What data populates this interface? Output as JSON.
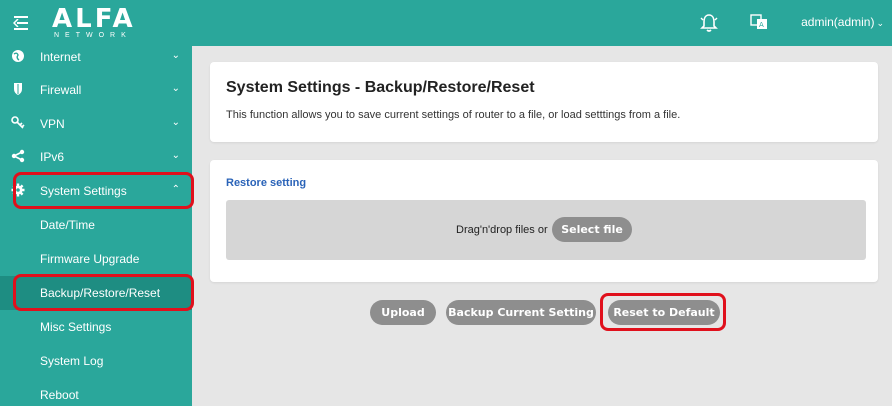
{
  "header": {
    "logo_text": "ALFA",
    "logo_sub": "NETWORK",
    "user_label": "admin(admin)"
  },
  "sidebar": {
    "items": [
      {
        "label": "Internet",
        "icon": "globe-icon"
      },
      {
        "label": "Firewall",
        "icon": "shield-icon"
      },
      {
        "label": "VPN",
        "icon": "key-icon"
      },
      {
        "label": "IPv6",
        "icon": "share-icon"
      },
      {
        "label": "System Settings",
        "icon": "gear-icon"
      }
    ],
    "sub_items": [
      {
        "label": "Date/Time"
      },
      {
        "label": "Firmware Upgrade"
      },
      {
        "label": "Backup/Restore/Reset"
      },
      {
        "label": "Misc Settings"
      },
      {
        "label": "System Log"
      },
      {
        "label": "Reboot"
      }
    ]
  },
  "main": {
    "title": "System Settings - Backup/Restore/Reset",
    "description": "This function allows you to save current settings of router to a file, or load setttings from a file.",
    "restore": {
      "section_title": "Restore setting",
      "dropzone_text": "Drag'n'drop files or",
      "select_file_label": "Select file"
    },
    "actions": {
      "upload_label": "Upload",
      "backup_label": "Backup Current Setting",
      "reset_label": "Reset to Default"
    }
  },
  "colors": {
    "brand_teal": "#2aa79b",
    "highlight_red": "#e0101c",
    "section_blue": "#2a63b8",
    "button_gray": "#8e8e8e"
  }
}
